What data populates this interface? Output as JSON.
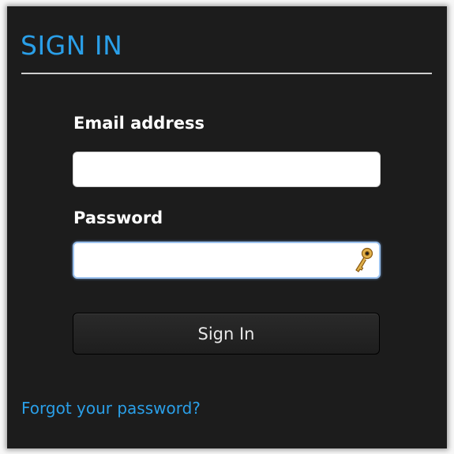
{
  "form": {
    "title": "SIGN IN",
    "email_label": "Email address",
    "email_value": "",
    "password_label": "Password",
    "password_value": "",
    "submit_label": "Sign In",
    "forgot_link": "Forgot your password?"
  },
  "icons": {
    "password_field_icon": "key-icon"
  },
  "colors": {
    "accent": "#2a9fe8",
    "panel_background": "#1c1c1c",
    "label_text": "#ffffff",
    "focus_ring": "#9cc2ee",
    "key_gold": "#d9a53a"
  }
}
